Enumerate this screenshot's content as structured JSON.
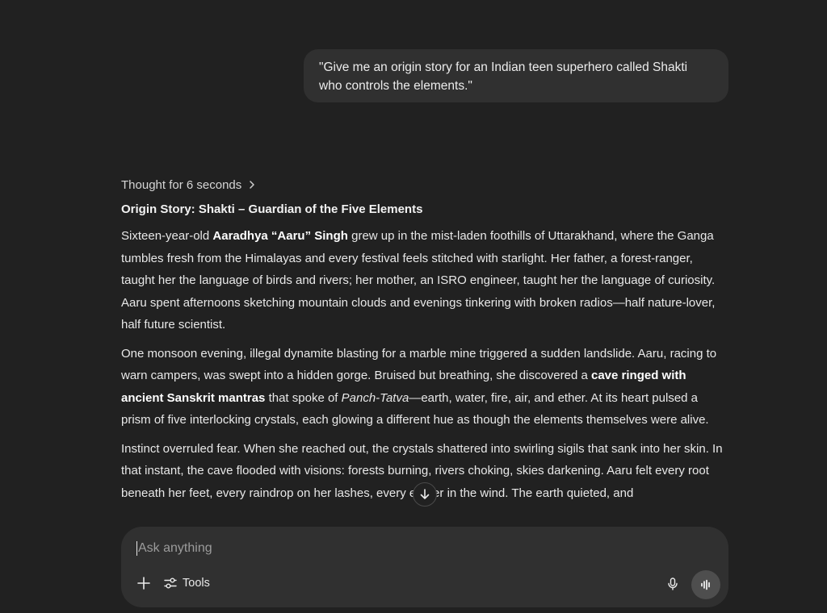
{
  "user_message": "\"Give me an origin story for an Indian teen superhero called Shakti who controls the elements.\"",
  "thought": {
    "label": "Thought for 6 seconds"
  },
  "heading": "Origin Story: Shakti – Guardian of the Five Elements",
  "p1": {
    "a": "Sixteen-year-old ",
    "b": "Aaradhya “Aaru” Singh",
    "c": " grew up in the mist-laden foothills of Uttarakhand, where the Ganga tumbles fresh from the Himalayas and every festival feels stitched with starlight. Her father, a forest-ranger, taught her the language of birds and rivers; her mother, an ISRO engineer, taught her the language of curiosity. Aaru spent afternoons sketching mountain clouds and evenings tinkering with broken radios—half nature-lover, half future scientist."
  },
  "p2": {
    "a": "One monsoon evening, illegal dynamite blasting for a marble mine triggered a sudden landslide. Aaru, racing to warn campers, was swept into a hidden gorge. Bruised but breathing, she discovered a ",
    "b": "cave ringed with ancient Sanskrit mantras",
    "c": " that spoke of ",
    "d": "Panch-Tatva",
    "e": "—earth, water, fire, air, and ether. At its heart pulsed a prism of five interlocking crystals, each glowing a different hue as though the elements themselves were alive."
  },
  "p3": {
    "a": "Instinct overruled fear. When she reached out, the crystals shattered into swirling sigils that sank into her skin. In that instant, the cave flooded with visions: forests burning, rivers choking, skies darkening. Aaru felt every root beneath her feet, every raindrop on her lashes, every ember in the wind. The earth quieted, and"
  },
  "composer": {
    "placeholder": "Ask anything",
    "tools_label": "Tools"
  },
  "icons": {
    "chevron": "chevron-right-icon",
    "scroll": "arrow-down-icon",
    "plus": "plus-icon",
    "tools": "sliders-icon",
    "mic": "microphone-icon",
    "voice": "voice-waveform-icon"
  }
}
